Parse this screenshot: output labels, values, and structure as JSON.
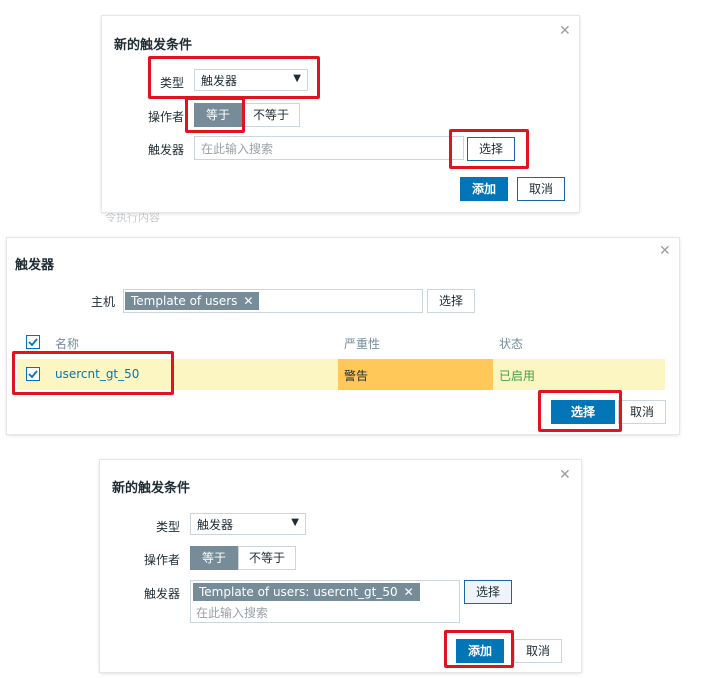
{
  "dialog1": {
    "title": "新的触发条件",
    "type_label": "类型",
    "type_value": "触发器",
    "operator_label": "操作者",
    "op_equal": "等于",
    "op_not_equal": "不等于",
    "trigger_label": "触发器",
    "search_placeholder": "在此输入搜索",
    "select_button": "选择",
    "add_button": "添加",
    "cancel_button": "取消"
  },
  "dialog2": {
    "title": "触发器",
    "host_label": "主机",
    "host_tag": "Template of users",
    "select_button": "选择",
    "columns": [
      "名称",
      "严重性",
      "状态"
    ],
    "row": {
      "name": "usercnt_gt_50",
      "severity": "警告",
      "status": "已启用"
    },
    "confirm_button": "选择",
    "cancel_button": "取消"
  },
  "dialog3": {
    "title": "新的触发条件",
    "type_label": "类型",
    "type_value": "触发器",
    "operator_label": "操作者",
    "op_equal": "等于",
    "op_not_equal": "不等于",
    "trigger_label": "触发器",
    "trigger_tag": "Template of users: usercnt_gt_50",
    "search_placeholder": "在此输入搜索",
    "select_button": "选择",
    "add_button": "添加",
    "cancel_button": "取消"
  },
  "background": {
    "fragment": "令执行内容"
  },
  "colors": {
    "primary": "#0275b8",
    "toggle_on": "#768d99",
    "highlight_row": "#fcf7c2",
    "severity_warning": "#ffc859",
    "status_enabled": "#429e47",
    "annotation": "#e0141e"
  },
  "icons": {
    "close": "close-icon",
    "chevron": "chevron-down-icon",
    "remove": "remove-tag-icon",
    "check": "checkbox-check-icon"
  }
}
